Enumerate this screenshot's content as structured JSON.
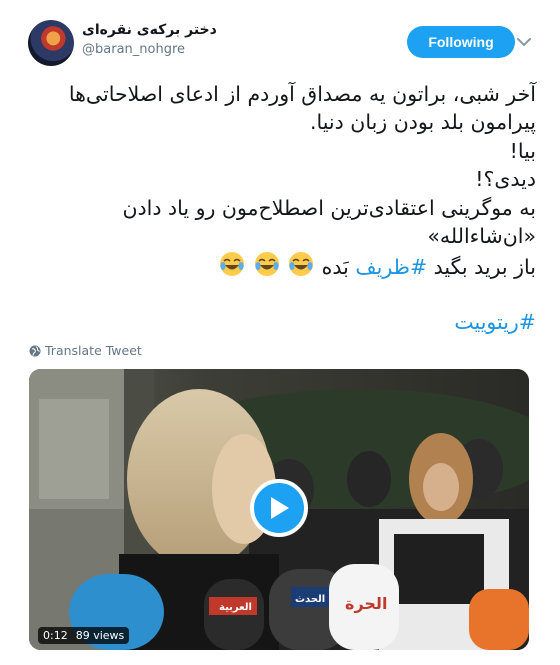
{
  "author": {
    "display_name": "دختر برکه‌ی نقره‌ای",
    "handle": "@baran_nohgre"
  },
  "follow_button": {
    "label": "Following"
  },
  "tweet": {
    "lines": [
      "آخر شبی، براتون یه مصداق آوردم از ادعای اصلاحاتی‌ها",
      "پیرامون بلد بودن زبان دنیا.",
      "بیا!",
      "دیدی؟!",
      "به موگرینی اعتقادی‌ترین اصطلاح‌مون رو یاد دادن",
      "«ان‌شاءالله»"
    ],
    "last_line_prefix": "باز برید بگید ",
    "last_line_hashtag": "#ظریف",
    "last_line_suffix": " بَده",
    "emoji": [
      "face-with-tears-of-joy",
      "face-with-tears-of-joy",
      "face-with-tears-of-joy"
    ],
    "hashtag": "#ریتوییت"
  },
  "translate": {
    "label": "Translate Tweet"
  },
  "video": {
    "time": "0:12",
    "views": "89 views",
    "channel_logos": [
      "العربية",
      "الحدث",
      "الحرة"
    ]
  },
  "colors": {
    "accent": "#1da1f2",
    "link": "#1b95e0",
    "secondary_text": "#657786"
  }
}
